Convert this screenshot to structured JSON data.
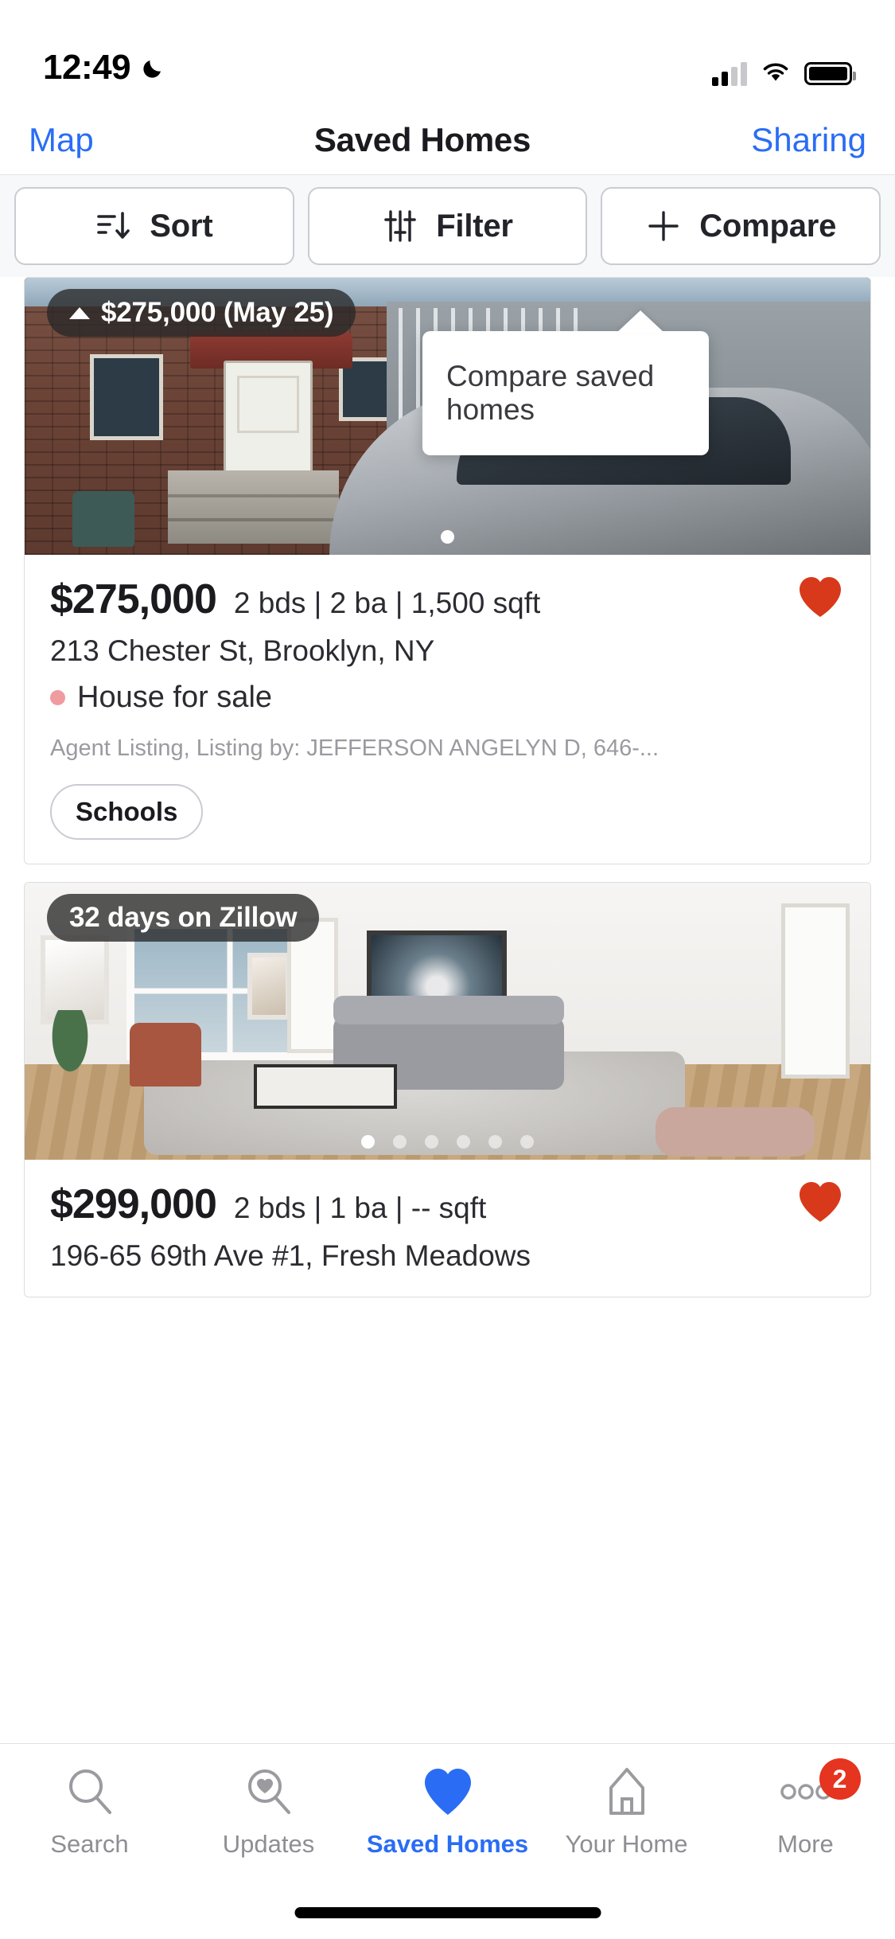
{
  "status_bar": {
    "time": "12:49",
    "dnd_icon": "crescent-moon-icon",
    "signal_icon": "cellular-signal-icon",
    "wifi_icon": "wifi-icon",
    "battery_icon": "battery-full-icon"
  },
  "navbar": {
    "left_link": "Map",
    "title": "Saved Homes",
    "right_link": "Sharing"
  },
  "toolbar": {
    "sort_label": "Sort",
    "filter_label": "Filter",
    "compare_label": "Compare",
    "sort_icon": "sort-descending-icon",
    "filter_icon": "sliders-icon",
    "compare_icon": "plus-icon"
  },
  "tooltip": {
    "text": "Compare saved homes"
  },
  "listings": [
    {
      "image_badge": "$275,000 (May 25)",
      "image_badge_direction": "up",
      "price": "$275,000",
      "facts": "2 bds | 2 ba | 1,500 sqft",
      "address": "213 Chester St, Brooklyn, NY",
      "status": "House for sale",
      "status_dot_color": "#ef9ba0",
      "agent": "Agent Listing, Listing by: JEFFERSON ANGELYN D, 646-...",
      "pill": "Schools",
      "saved": true,
      "heart_color": "#d8391b",
      "photo_dots": 1,
      "photo_active_dot": 0
    },
    {
      "image_badge": "32 days on Zillow",
      "price": "$299,000",
      "facts": "2 bds | 1 ba | -- sqft",
      "address": "196-65 69th Ave #1, Fresh Meadows",
      "saved": true,
      "heart_color": "#d8391b",
      "photo_dots": 6,
      "photo_active_dot": 0
    }
  ],
  "tabbar": {
    "items": [
      {
        "label": "Search",
        "icon": "magnifier-icon",
        "active": false,
        "badge": null
      },
      {
        "label": "Updates",
        "icon": "magnifier-heart-icon",
        "active": false,
        "badge": null
      },
      {
        "label": "Saved Homes",
        "icon": "heart-filled-icon",
        "active": true,
        "badge": null
      },
      {
        "label": "Your Home",
        "icon": "house-outline-icon",
        "active": false,
        "badge": null
      },
      {
        "label": "More",
        "icon": "ellipsis-icon",
        "active": false,
        "badge": "2"
      }
    ],
    "active_color": "#2a6df4",
    "inactive_color": "#8e8e93",
    "badge_color": "#e5341f"
  }
}
